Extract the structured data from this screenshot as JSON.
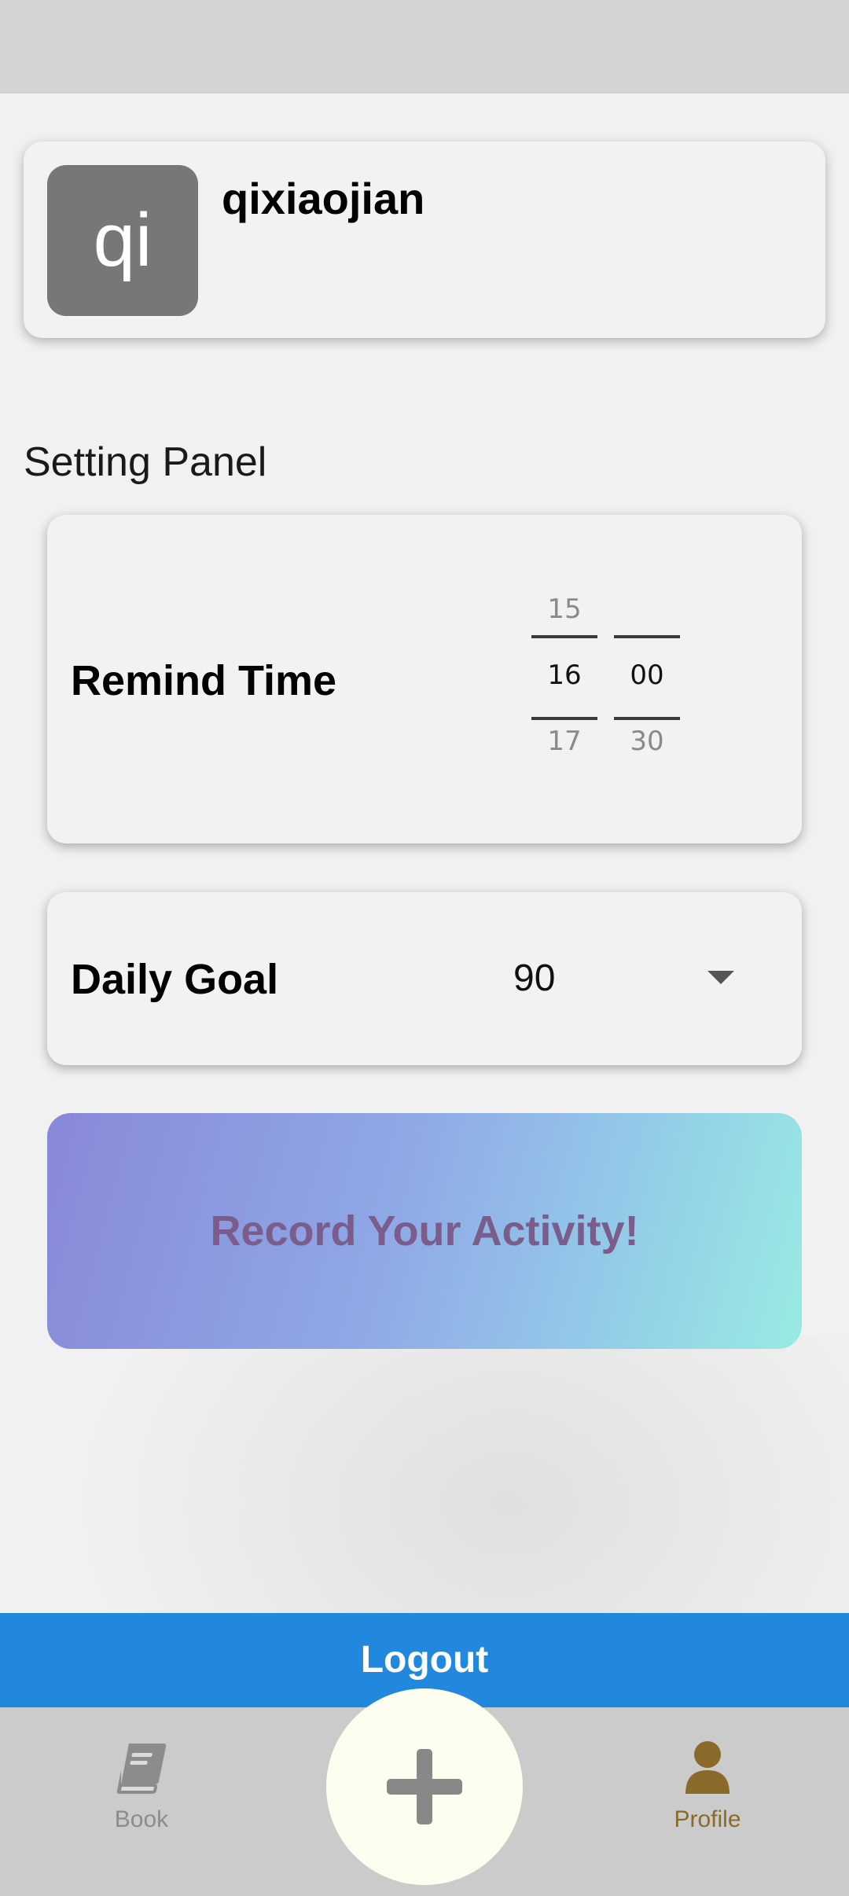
{
  "profile": {
    "avatar_text": "qi",
    "username": "qixiaojian"
  },
  "settings": {
    "title": "Setting Panel",
    "remind_time": {
      "label": "Remind Time",
      "hour_prev": "15",
      "hour_current": "16",
      "hour_next": "17",
      "minute_prev": "",
      "minute_current": "00",
      "minute_next": "30"
    },
    "daily_goal": {
      "label": "Daily Goal",
      "value": "90"
    }
  },
  "record_button": {
    "label": "Record Your Activity!"
  },
  "logout": {
    "label": "Logout"
  },
  "bottom_nav": {
    "book_label": "Book",
    "profile_label": "Profile",
    "book_icon": "book-icon",
    "add_icon": "plus-icon",
    "profile_icon": "person-icon"
  },
  "colors": {
    "accent_blue": "#2188dd",
    "profile_active": "#8a6a2a",
    "record_text": "#7b5d8c"
  }
}
